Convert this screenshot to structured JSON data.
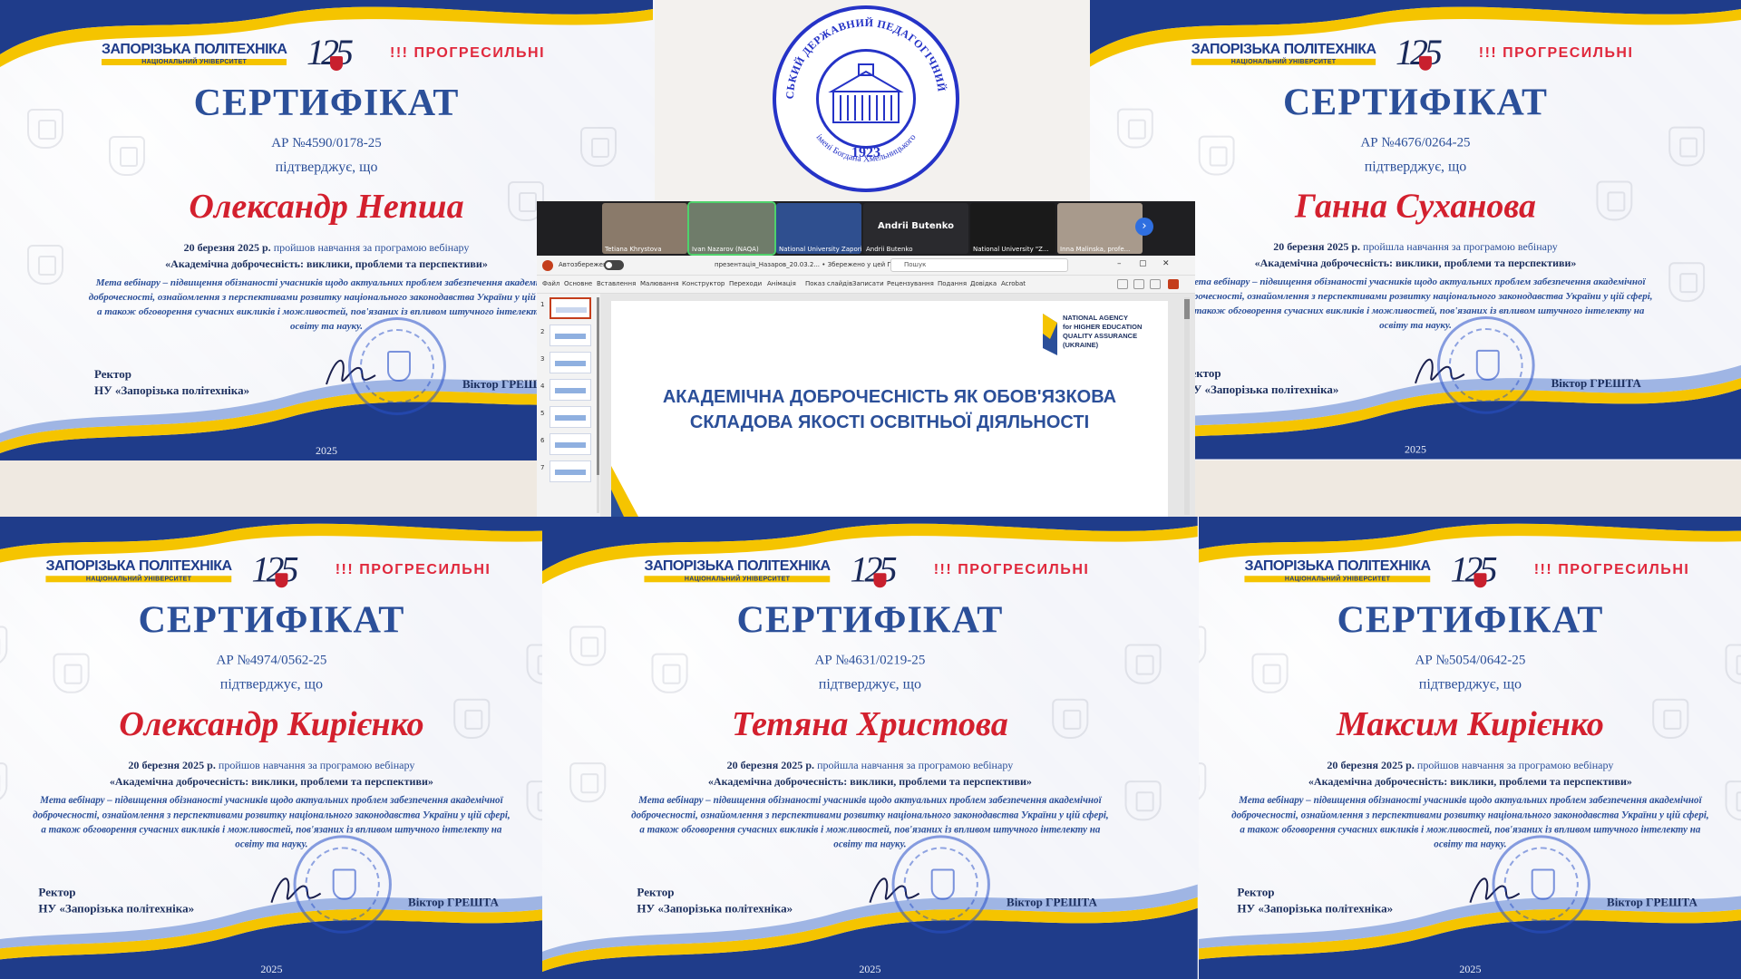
{
  "certificates": [
    {
      "number": "АР №4590/0178-25",
      "name": "Олександр Непша",
      "completed": "пройшов навчання за програмою вебінару"
    },
    {
      "number": "АР №4676/0264-25",
      "name": "Ганна Суханова",
      "completed": "пройшла навчання за програмою вебінару"
    },
    {
      "number": "АР №4974/0562-25",
      "name": "Олександр Кирієнко",
      "completed": "пройшов навчання за програмою вебінару"
    },
    {
      "number": "АР №4631/0219-25",
      "name": "Тетяна Христова",
      "completed": "пройшла навчання за програмою вебінару"
    },
    {
      "number": "АР №5054/0642-25",
      "name": "Максим Кирієнко",
      "completed": "пройшов навчання за програмою вебінару"
    }
  ],
  "certificate_common": {
    "logo_zp": "ЗАПОРІЗЬКА ПОЛІТЕХНІКА",
    "logo_zp_sub": "НАЦІОНАЛЬНИЙ УНІВЕРСИТЕТ",
    "logo_125": "125",
    "logo_prog": "ПРОГРЕСИЛЬНІ",
    "logo_prog_mark": "!!!",
    "title": "СЕРТИФІКАТ",
    "confirms": "підтверджує, що",
    "date": "20 березня 2025 р.",
    "webinar": "«Академічна доброчесність: виклики, проблеми та перспективи»",
    "goal": "Мета вебінару – підвищення обізнаності учасників щодо актуальних проблем забезпечення академічної доброчесності, ознайомлення з перспективами розвитку національного законодавства України у цій сфері, а також обговорення сучасних викликів і можливостей, пов'язаних із впливом штучного інтелекту на освіту та науку.",
    "rector_label": "Ректор",
    "rector_org": "НУ «Запорізька політехніка»",
    "signer": "Віктор ГРЕШТА",
    "year": "2025"
  },
  "seal": {
    "ring_text": "МЕЛІТОПОЛЬСЬКИЙ ДЕРЖАВНИЙ ПЕДАГОГІЧНИЙ УНІВЕРСИТЕТ",
    "bottom_text": "імені Богдана Хмельницького",
    "year": "1923"
  },
  "meeting": {
    "participants": [
      {
        "name": "Tetiana Khrystova"
      },
      {
        "name": "Ivan Nazarov (NAQA)"
      },
      {
        "name": "National University Zaporizhzhia..."
      },
      {
        "name": "Andrii Butenko",
        "display": "Andrii Butenko"
      },
      {
        "name": "National University \"Z..."
      },
      {
        "name": "Inna Malinska, profe..."
      }
    ],
    "next_icon": "chevron-right-icon"
  },
  "powerpoint": {
    "autosave": "Автозбереження",
    "doc_name": "презентація_Назаров_20.03.2... • Збережено у цей ПК",
    "search_placeholder": "Пошук",
    "menu": [
      "Файл",
      "Основне",
      "Вставлення",
      "Малювання",
      "Конструктор",
      "Переходи",
      "Анімація",
      "Показ слайдів",
      "Записати",
      "Рецензування",
      "Подання",
      "Довідка",
      "Acrobat"
    ],
    "thumb_numbers": [
      "1",
      "2",
      "3",
      "4",
      "5",
      "6",
      "7"
    ],
    "slide_title_line1": "АКАДЕМІЧНА ДОБРОЧЕСНІСТЬ ЯК ОБОВ'ЯЗКОВА",
    "slide_title_line2": "СКЛАДОВА ЯКОСТІ ОСВІТНЬОЇ ДІЯЛЬНОСТІ",
    "agency_line1": "NATIONAL AGENCY",
    "agency_line2": "for HIGHER EDUCATION",
    "agency_line3": "QUALITY ASSURANCE",
    "agency_line4": "(UKRAINE)"
  },
  "colors": {
    "navy": "#2b4f99",
    "red": "#d3202e",
    "yellow": "#f5c400",
    "seal_blue": "#2533c7"
  }
}
